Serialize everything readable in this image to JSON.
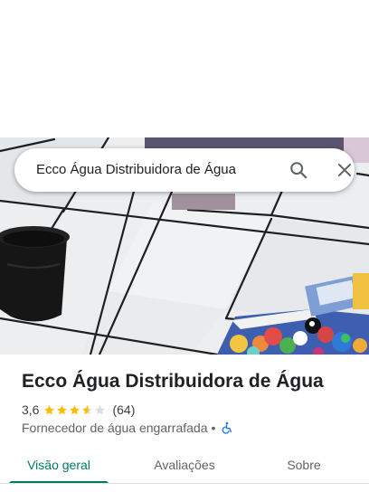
{
  "search": {
    "query": "Ecco Água Distribuidora de Água"
  },
  "place": {
    "name": "Ecco Água Distribuidora de Água",
    "rating_text": "3,6",
    "rating": 3.6,
    "review_count_text": "(64)",
    "category": "Fornecedor de água engarrafada",
    "separator": "•"
  },
  "tabs": [
    {
      "label": "Visão geral",
      "active": true
    },
    {
      "label": "Avaliações",
      "active": false
    },
    {
      "label": "Sobre",
      "active": false
    }
  ],
  "icons": {
    "search": "search-icon",
    "close": "close-icon",
    "star": "star-icon",
    "accessibility": "wheelchair-icon"
  },
  "colors": {
    "accent": "#00796b",
    "star": "#fbbc04",
    "star_empty": "#dadce0",
    "accessibility": "#1a73e8"
  }
}
